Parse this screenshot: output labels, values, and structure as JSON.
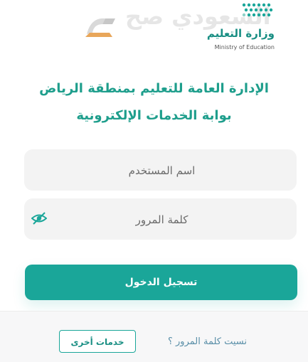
{
  "header": {
    "watermark_text": "السعودي صح",
    "ministry_name_ar": "وزارة التعليم",
    "ministry_name_en": "Ministry of Education"
  },
  "titles": {
    "line1": "الإدارة العامة للتعليم بمنطقة الرياض",
    "line2": "بوابة الخدمات الإلكترونية"
  },
  "form": {
    "username_placeholder": "اسم المستخدم",
    "password_placeholder": "كلمة المرور",
    "login_label": "تسجيل الدخول"
  },
  "footer": {
    "forgot_password": "نسيت كلمة المرور ؟",
    "other_services": "خدمات أخرى"
  },
  "colors": {
    "accent": "#1aa699",
    "title": "#1e9e8c"
  }
}
